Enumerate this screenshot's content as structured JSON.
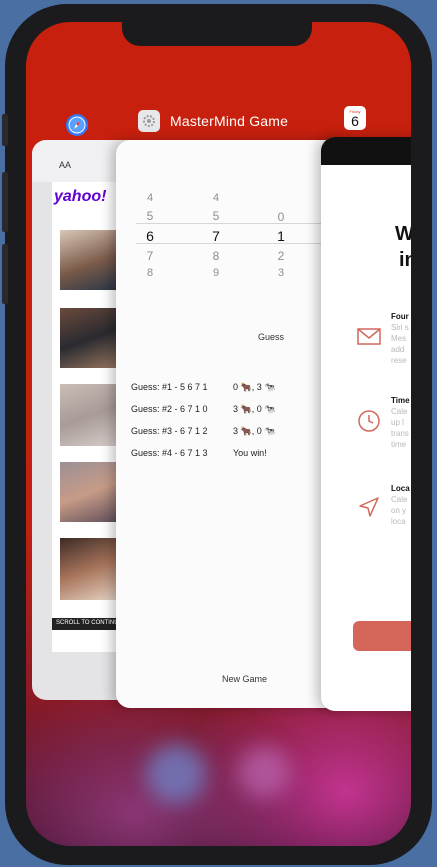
{
  "switcher": {
    "main_app_title": "MasterMind Game",
    "calendar_icon_day": "6",
    "calendar_icon_weekday": "Friday"
  },
  "safari_card": {
    "text_size_label": "AA",
    "logo": "yahoo!",
    "scroll_label": "SCROLL TO CONTINUE"
  },
  "mastermind": {
    "picker_columns": [
      [
        "4",
        "5",
        "6",
        "7",
        "8"
      ],
      [
        "4",
        "5",
        "7",
        "8",
        "9"
      ],
      [
        "0",
        "1",
        "2",
        "3"
      ]
    ],
    "picker_selected": [
      "6",
      "7",
      "1"
    ],
    "guess_label": "Guess",
    "history": [
      {
        "guess": "Guess: #1 - 5 6 7 1",
        "result": "0 🐂, 3 🐄"
      },
      {
        "guess": "Guess: #2 - 6 7 1 0",
        "result": "3 🐂, 0 🐄"
      },
      {
        "guess": "Guess: #3 - 6 7 1 2",
        "result": "3 🐂, 0 🐄"
      },
      {
        "guess": "Guess: #4 - 6 7 1 3",
        "result": "You win!"
      }
    ],
    "new_game_label": "New Game"
  },
  "calendar_card": {
    "title_line1": "W",
    "title_line2": "in",
    "features": [
      {
        "icon": "envelope-icon",
        "title": "Four",
        "desc": [
          "Siri s",
          "Mes",
          "add",
          "rese"
        ]
      },
      {
        "icon": "clock-icon",
        "title": "Time",
        "desc": [
          "Cale",
          "up l",
          "trans",
          "time"
        ]
      },
      {
        "icon": "location-arrow-icon",
        "title": "Loca",
        "desc": [
          "Cale",
          "on y",
          "loca"
        ]
      }
    ],
    "accent_color": "#d4675a"
  }
}
